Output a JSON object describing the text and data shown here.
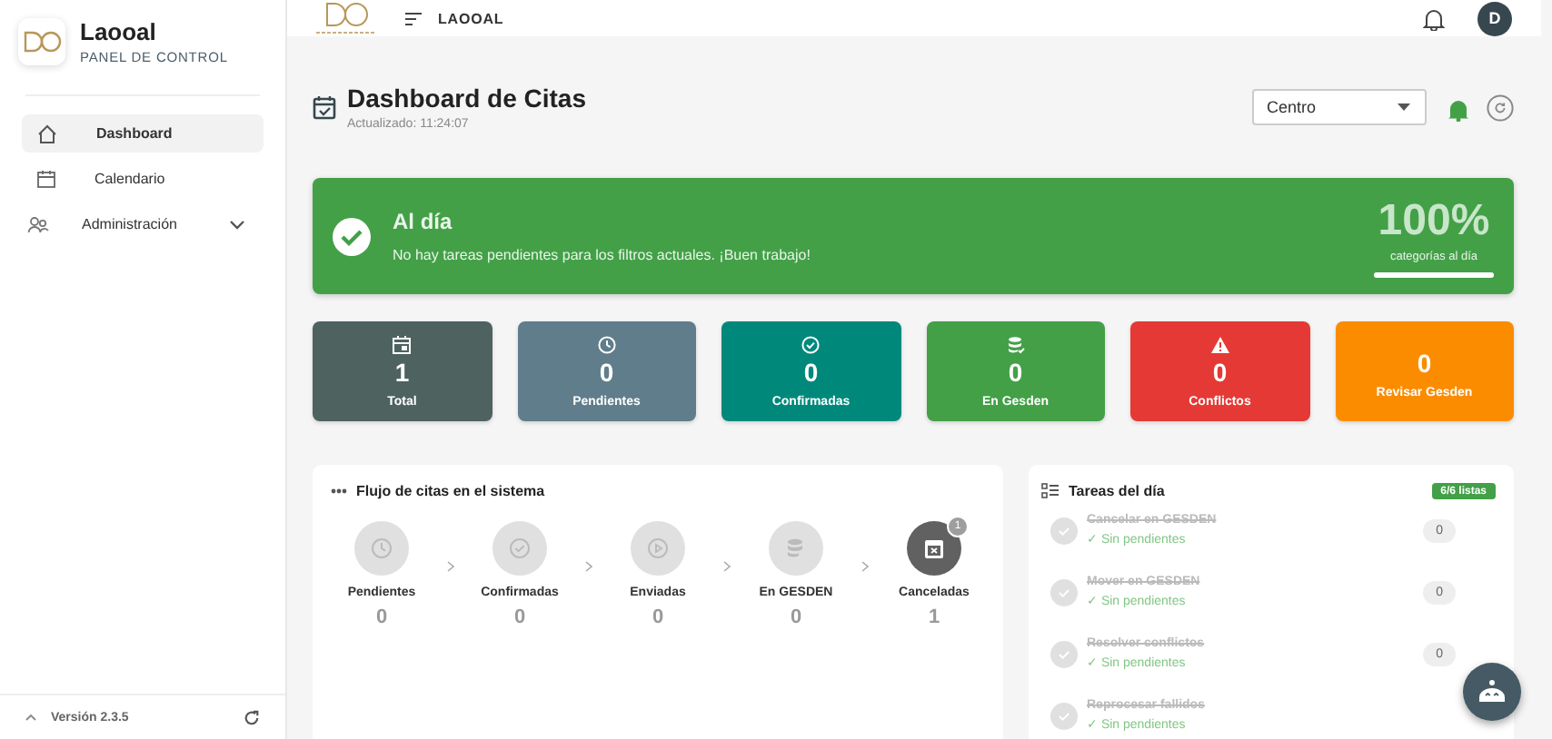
{
  "sidebar": {
    "brand": "Laooal",
    "subtitle": "PANEL DE CONTROL",
    "items": [
      {
        "label": "Dashboard",
        "kind": "home",
        "selected": true
      },
      {
        "label": "Calendario",
        "kind": "calendar",
        "selected": false
      },
      {
        "label": "Administración",
        "kind": "admin",
        "selected": false,
        "expanded": false
      }
    ],
    "version": "Versión 2.3.5"
  },
  "topbar": {
    "title": "LAOOAL",
    "avatar": "D"
  },
  "header": {
    "title": "Dashboard de Citas",
    "updated": "Actualizado: 11:24:07",
    "center_select": "Centro"
  },
  "banner": {
    "title": "Al día",
    "message": "No hay tareas pendientes para los filtros actuales. ¡Buen trabajo!",
    "percent": "100%",
    "percent_label": "categorías al día",
    "level": 1
  },
  "stats": [
    {
      "value": "1",
      "label": "Total",
      "kind": "calendar",
      "color": "#4e6360"
    },
    {
      "value": "0",
      "label": "Pendientes",
      "kind": "clock",
      "color": "#607d8b"
    },
    {
      "value": "0",
      "label": "Confirmadas",
      "kind": "check",
      "color": "#00897b"
    },
    {
      "value": "0",
      "label": "En Gesden",
      "kind": "database",
      "color": "#43a047"
    },
    {
      "value": "0",
      "label": "Conflictos",
      "kind": "warning",
      "color": "#e53935"
    },
    {
      "value": "0",
      "label": "Revisar Gesden",
      "kind": "plain",
      "color": "#fb8c00"
    }
  ],
  "flow": {
    "title": "Flujo de citas en el sistema",
    "steps": [
      {
        "label": "Pendientes",
        "count": "0",
        "kind": "clock",
        "active": false
      },
      {
        "label": "Confirmadas",
        "count": "0",
        "kind": "check",
        "active": false
      },
      {
        "label": "Enviadas",
        "count": "0",
        "kind": "play",
        "active": false
      },
      {
        "label": "En GESDEN",
        "count": "0",
        "kind": "database",
        "active": false
      },
      {
        "label": "Canceladas",
        "count": "1",
        "kind": "cancel",
        "active": true,
        "badge": "1"
      }
    ]
  },
  "tasks": {
    "title": "Tareas del día",
    "badge": "6/6 listas",
    "items": [
      {
        "title": "Cancelar en GESDEN",
        "status": "✓ Sin pendientes",
        "count": "0",
        "done": true
      },
      {
        "title": "Mover en GESDEN",
        "status": "✓ Sin pendientes",
        "count": "0",
        "done": true
      },
      {
        "title": "Resolver conflictos",
        "status": "✓ Sin pendientes",
        "count": "0",
        "done": true
      },
      {
        "title": "Reprocesar fallidos",
        "status": "✓ Sin pendientes",
        "done": true
      }
    ]
  }
}
